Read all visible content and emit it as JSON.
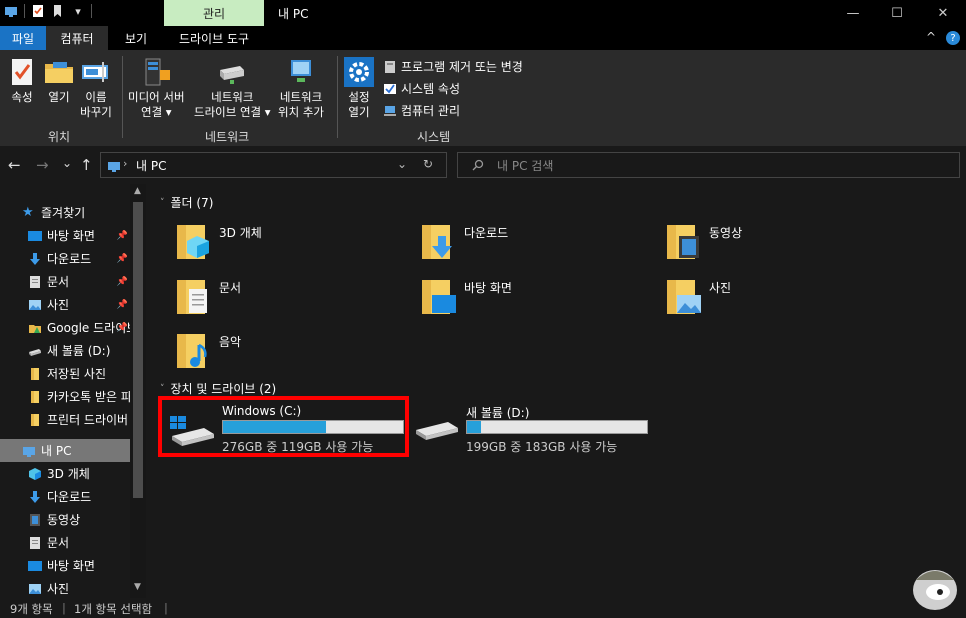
{
  "window": {
    "title": "내 PC",
    "context_tab": "관리",
    "minimize": "—",
    "maximize": "☐",
    "close": "✕"
  },
  "ribbon_tabs": {
    "file": "파일",
    "computer": "컴퓨터",
    "view": "보기",
    "drive_tools": "드라이브 도구",
    "collapse": "^",
    "help": "?"
  },
  "ribbon": {
    "location": {
      "label": "위치",
      "properties": "속성",
      "open": "열기",
      "rename_1": "이름",
      "rename_2": "바꾸기"
    },
    "network": {
      "label": "네트워크",
      "media_1": "미디어 서버",
      "media_2": "연결 ▾",
      "map_1": "네트워크",
      "map_2": "드라이브 연결 ▾",
      "add_1": "네트워크",
      "add_2": "위치 추가"
    },
    "system": {
      "label": "시스템",
      "settings_1": "설정",
      "settings_2": "열기",
      "uninstall": "프로그램 제거 또는 변경",
      "sysprops": "시스템 속성",
      "manage": "컴퓨터 관리"
    }
  },
  "address": {
    "back": "←",
    "forward": "→",
    "recent": "⌄",
    "up": "↑",
    "path": "내 PC",
    "dropdown": "⌄",
    "refresh": "↻",
    "search_placeholder": "내 PC 검색"
  },
  "nav": {
    "favorites": "즐겨찾기",
    "fav_items": [
      "바탕 화면",
      "다운로드",
      "문서",
      "사진",
      "Google 드라이브",
      "새 볼륨 (D:)",
      "저장된 사진",
      "카카오톡 받은 파일",
      "프린터 드라이버"
    ],
    "this_pc": "내 PC",
    "pc_items": [
      "3D 개체",
      "다운로드",
      "동영상",
      "문서",
      "바탕 화면",
      "사진"
    ]
  },
  "folders_header": "폴더 (7)",
  "folders": [
    "3D 개체",
    "다운로드",
    "동영상",
    "문서",
    "바탕 화면",
    "사진",
    "음악"
  ],
  "drives_header": "장치 및 드라이브 (2)",
  "drives": [
    {
      "name": "Windows (C:)",
      "space": "276GB 중 119GB 사용 가능",
      "used_fraction": 0.57
    },
    {
      "name": "새 볼륨 (D:)",
      "space": "199GB 중 183GB 사용 가능",
      "used_fraction": 0.08
    }
  ],
  "status": {
    "items": "9개 항목",
    "selected": "1개 항목 선택함"
  },
  "colors": {
    "accent": "#1a73c5",
    "highlight": "#ff0000",
    "drive_fill": "#26a0da",
    "context_tab": "#c8ecc1"
  }
}
